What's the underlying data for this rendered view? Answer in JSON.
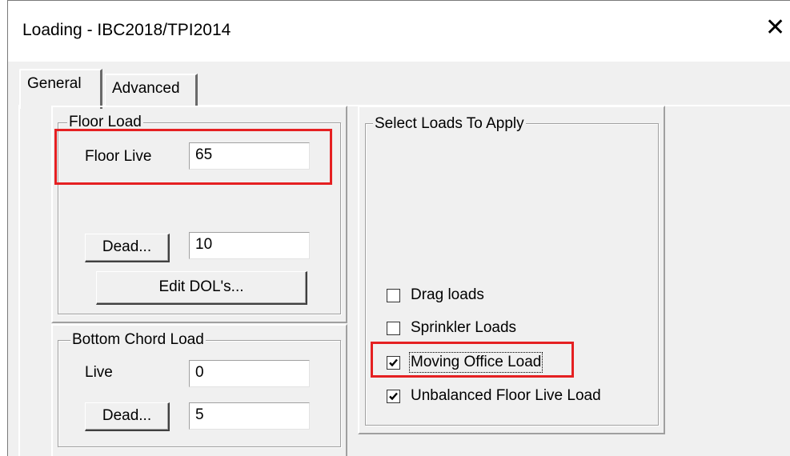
{
  "window": {
    "title": "Loading - IBC2018/TPI2014",
    "close_glyph": "✕"
  },
  "tabs": [
    {
      "label": "General",
      "selected": true
    },
    {
      "label": "Advanced",
      "selected": false
    }
  ],
  "floor_load": {
    "group_label": "Floor Load",
    "live_label": "Floor Live",
    "live_value": "65",
    "dead_button_label": "Dead...",
    "dead_value": "10",
    "edit_dols_label": "Edit DOL's..."
  },
  "bottom_chord_load": {
    "group_label": "Bottom Chord Load",
    "live_label": "Live",
    "live_value": "0",
    "dead_button_label": "Dead...",
    "dead_value": "5"
  },
  "select_loads": {
    "group_label": "Select Loads To Apply",
    "options": [
      {
        "label": "Drag loads",
        "checked": false
      },
      {
        "label": "Sprinkler Loads",
        "checked": false
      },
      {
        "label": "Moving Office Load",
        "checked": true
      },
      {
        "label": "Unbalanced Floor Live Load",
        "checked": true
      }
    ]
  },
  "highlight_color": "#e52022"
}
